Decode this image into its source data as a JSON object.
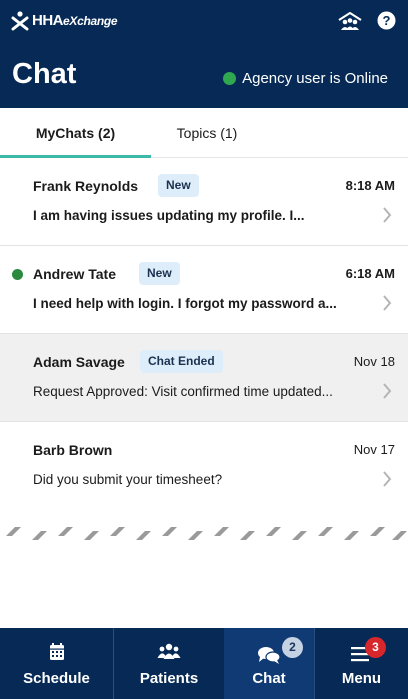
{
  "app": {
    "brand_main": "HHA",
    "brand_sub": "eXchange",
    "icons": [
      "hha-logo-icon",
      "agency-group-icon",
      "help-icon"
    ]
  },
  "header": {
    "title": "Chat",
    "status_text": "Agency user is Online",
    "status_color": "#2fa84f"
  },
  "tabs": [
    {
      "label": "MyChats (2)",
      "active": true
    },
    {
      "label": "Topics (1)",
      "active": false
    }
  ],
  "chats": [
    {
      "name": "Frank Reynolds",
      "badge": "New",
      "time": "8:18 AM",
      "message": "I am having issues updating my profile. I...",
      "online": false,
      "ended": false
    },
    {
      "name": "Andrew Tate",
      "badge": "New",
      "time": "6:18 AM",
      "message": "I need help with login. I forgot my password a...",
      "online": true,
      "ended": false
    },
    {
      "name": "Adam Savage",
      "badge": "Chat Ended",
      "time": "Nov 18",
      "message": "Request Approved: Visit confirmed time updated...",
      "online": false,
      "ended": true
    },
    {
      "name": "Barb Brown",
      "badge": "",
      "time": "Nov 17",
      "message": "Did you submit your timesheet?",
      "online": false,
      "ended": false
    }
  ],
  "nav": [
    {
      "label": "Schedule",
      "icon": "calendar-icon",
      "active": false
    },
    {
      "label": "Patients",
      "icon": "patients-icon",
      "active": false
    },
    {
      "label": "Chat",
      "icon": "chat-icon",
      "active": true,
      "badge": "2"
    },
    {
      "label": "Menu",
      "icon": "menu-icon",
      "active": false,
      "badge": "3"
    }
  ],
  "colors": {
    "navy": "#062a55",
    "accent_teal": "#3cb9a9",
    "badge_bg": "#ddeefa",
    "alert_red": "#d8262d"
  }
}
